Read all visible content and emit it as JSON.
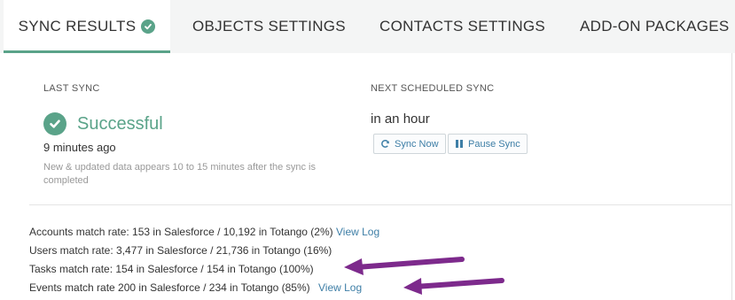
{
  "tabs": [
    {
      "label": "Sync Results",
      "active": true,
      "icon": "check-circle-icon"
    },
    {
      "label": "Objects Settings",
      "active": false
    },
    {
      "label": "Contacts Settings",
      "active": false
    },
    {
      "label": "Add-on Packages",
      "active": false
    }
  ],
  "last_sync": {
    "label": "Last Sync",
    "status": "Successful",
    "status_icon": "check-circle-icon",
    "ago": "9 minutes ago",
    "hint": "New & updated data appears 10 to 15 minutes after the sync is completed"
  },
  "next_sync": {
    "label": "Next Scheduled Sync",
    "value": "in an hour",
    "sync_now_label": "Sync Now",
    "pause_label": "Pause Sync"
  },
  "rates": [
    {
      "text": "Accounts match rate: 153 in Salesforce / 10,192 in Totango (2%)",
      "link": "View Log"
    },
    {
      "text": "Users match rate: 3,477 in Salesforce / 21,736 in Totango (16%)",
      "link": ""
    },
    {
      "text": "Tasks match rate: 154 in Salesforce / 154 in Totango (100%)",
      "link": ""
    },
    {
      "text": "Events match rate  200 in Salesforce / 234 in Totango (85%)",
      "link": "View Log"
    }
  ],
  "colors": {
    "accent_green": "#5aa389",
    "link_blue": "#3d7ea6",
    "annotation_arrow": "#7d2a8c"
  }
}
